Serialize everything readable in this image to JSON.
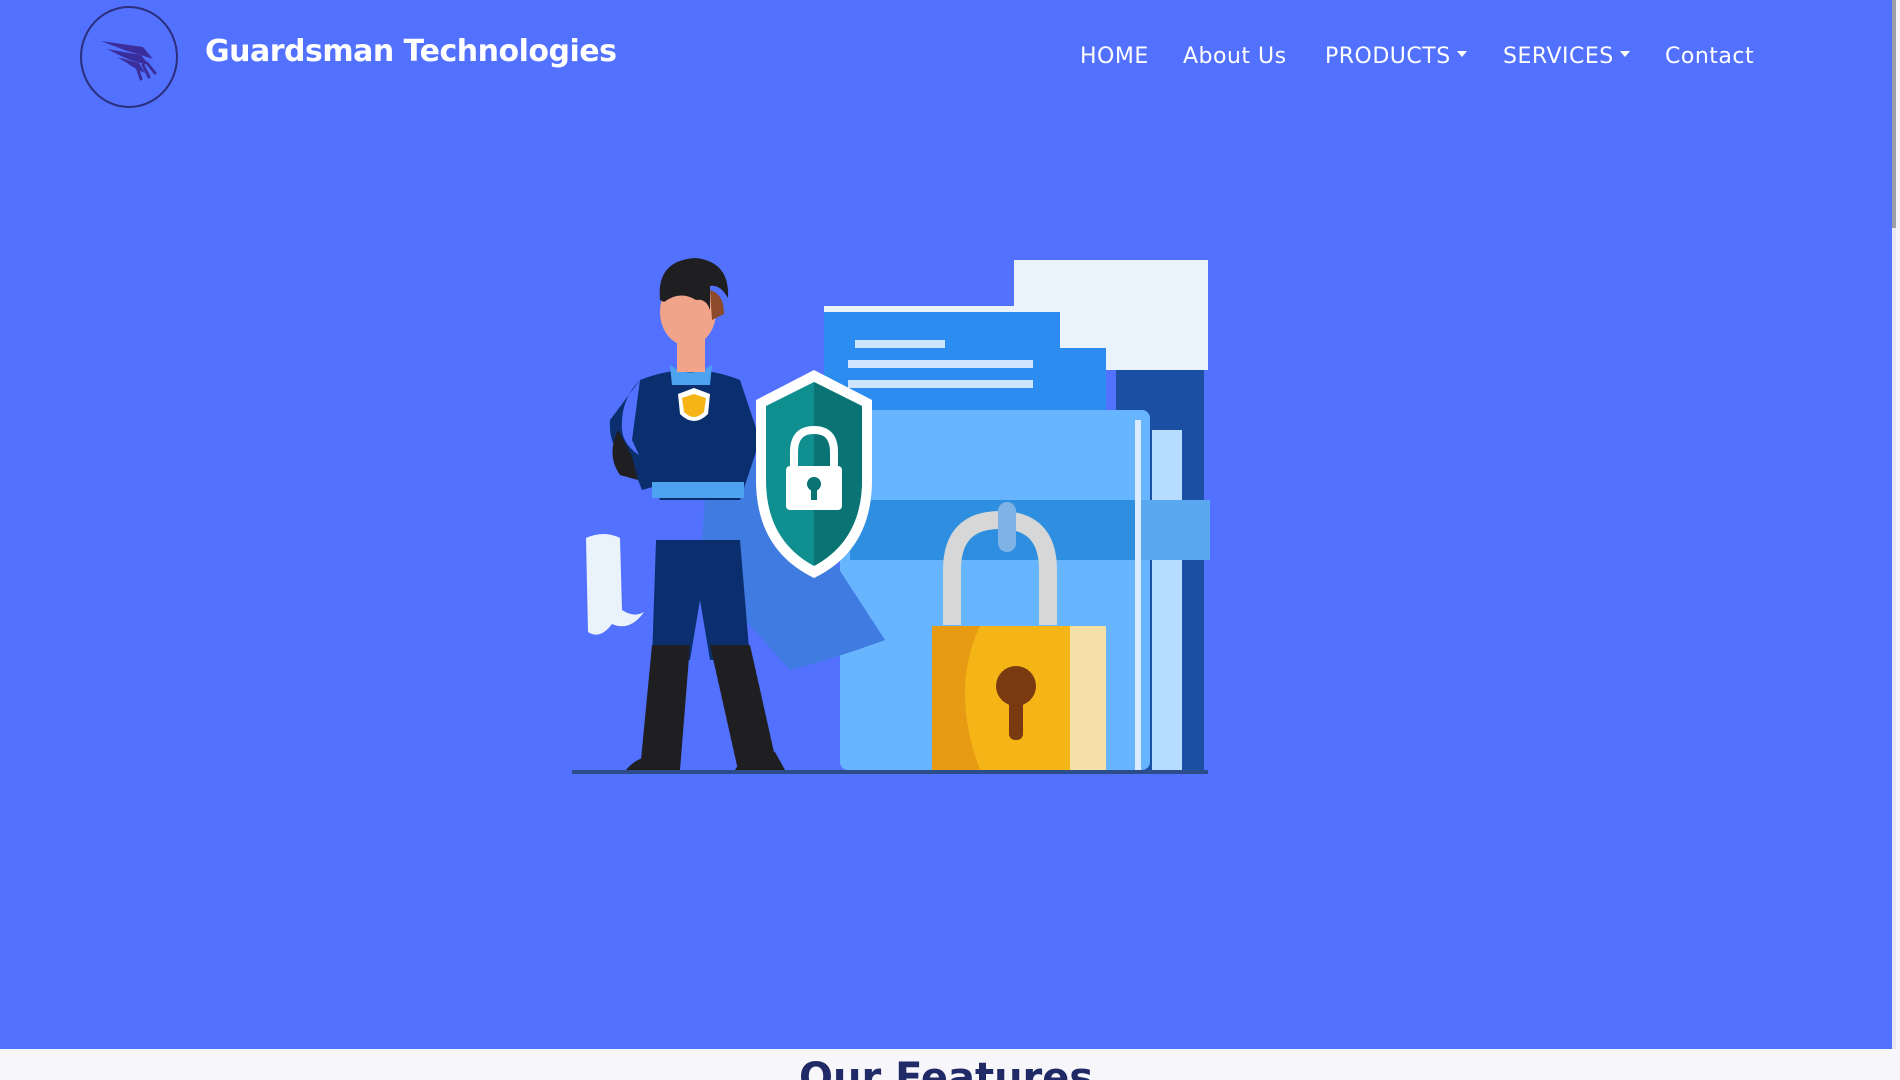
{
  "brand": {
    "name": "Guardsman Technologies",
    "logo_icon": "wing-icon"
  },
  "nav": {
    "items": [
      {
        "label": "HOME",
        "dropdown": false
      },
      {
        "label": "About Us",
        "dropdown": false
      },
      {
        "label": "PRODUCTS",
        "dropdown": true
      },
      {
        "label": "SERVICES",
        "dropdown": true
      },
      {
        "label": "Contact",
        "dropdown": false
      }
    ]
  },
  "hero": {
    "illustration": "security-hero-shield-lock-folder"
  },
  "features": {
    "title": "Our Features"
  },
  "colors": {
    "hero_background": "#5271ff",
    "brand_text": "#ffffff",
    "features_title": "#1f2a66",
    "page_background": "#f7f6fb"
  }
}
